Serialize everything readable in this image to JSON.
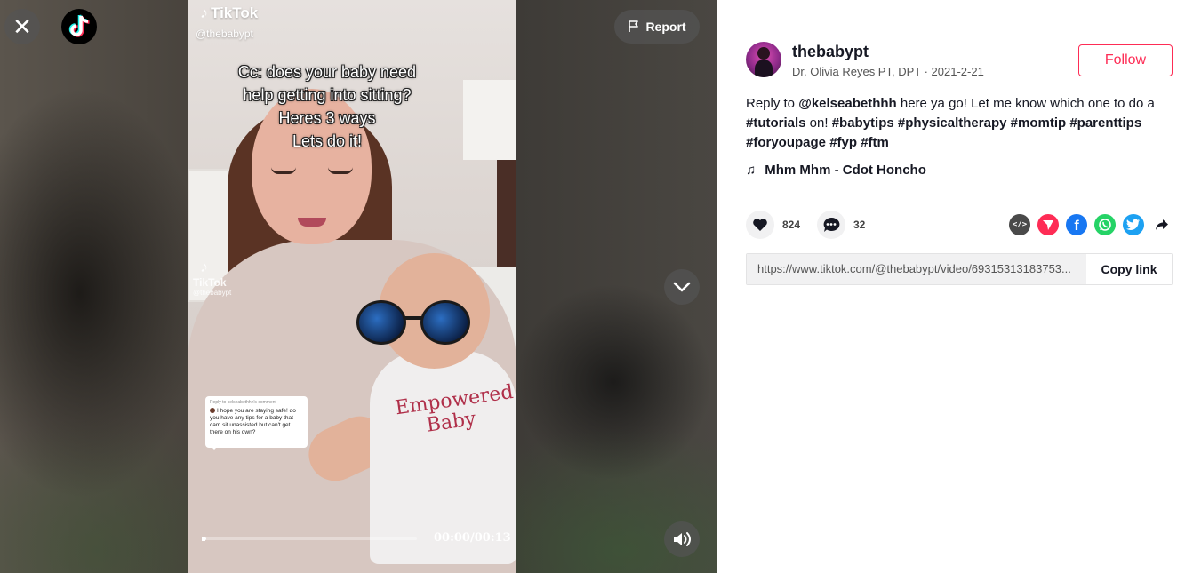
{
  "video": {
    "watermark_name": "TikTok",
    "watermark_user": "@thebabypt",
    "watermark2_name": "TikTok",
    "watermark2_user": "@thebabypt",
    "caption_lines": [
      "Cc: does your baby need",
      "help getting into sitting?",
      "Heres 3 ways",
      "Lets do it!"
    ],
    "reply_card": {
      "header": "Reply to kelseabethhh's comment",
      "text": "I hope you are staying safe! do you have any tips for a baby that cam sit unassisted but can't get there on his own?"
    },
    "shirt_text": [
      "Empowered",
      "Baby"
    ],
    "progress": 0.02,
    "time": "00:00/00:13",
    "report_label": "Report"
  },
  "icons": {
    "close": "close-icon",
    "logo": "tiktok-logo-icon",
    "report": "flag-icon",
    "down": "chevron-down-icon",
    "sound": "volume-icon"
  },
  "author": {
    "username": "thebabypt",
    "display_name": "Dr. Olivia Reyes PT, DPT",
    "separator": " · ",
    "date": "2021-2-21",
    "follow_label": "Follow"
  },
  "description": {
    "prefix": "Reply to ",
    "mention": "@kelseabethhh",
    "text": " here ya go! Let me know which one to do a ",
    "tags": [
      "#tutorials",
      "#babytips",
      "#physicaltherapy",
      "#momtip",
      "#parenttips",
      "#foryoupage",
      "#fyp",
      "#ftm"
    ],
    "after_first_tag": " on! "
  },
  "music": {
    "title": "Mhm Mhm - Cdot Honcho"
  },
  "stats": {
    "likes": "824",
    "comments": "32"
  },
  "share": [
    "embed",
    "send-to-friends",
    "facebook",
    "whatsapp",
    "twitter",
    "more-share"
  ],
  "link": {
    "url": "https://www.tiktok.com/@thebabypt/video/69315313183753...",
    "copy_label": "Copy link"
  },
  "colors": {
    "accent": "#fe2c55",
    "facebook": "#1877f2",
    "whatsapp": "#25d366",
    "twitter": "#1da1f2",
    "embed": "#4a4a4a"
  }
}
